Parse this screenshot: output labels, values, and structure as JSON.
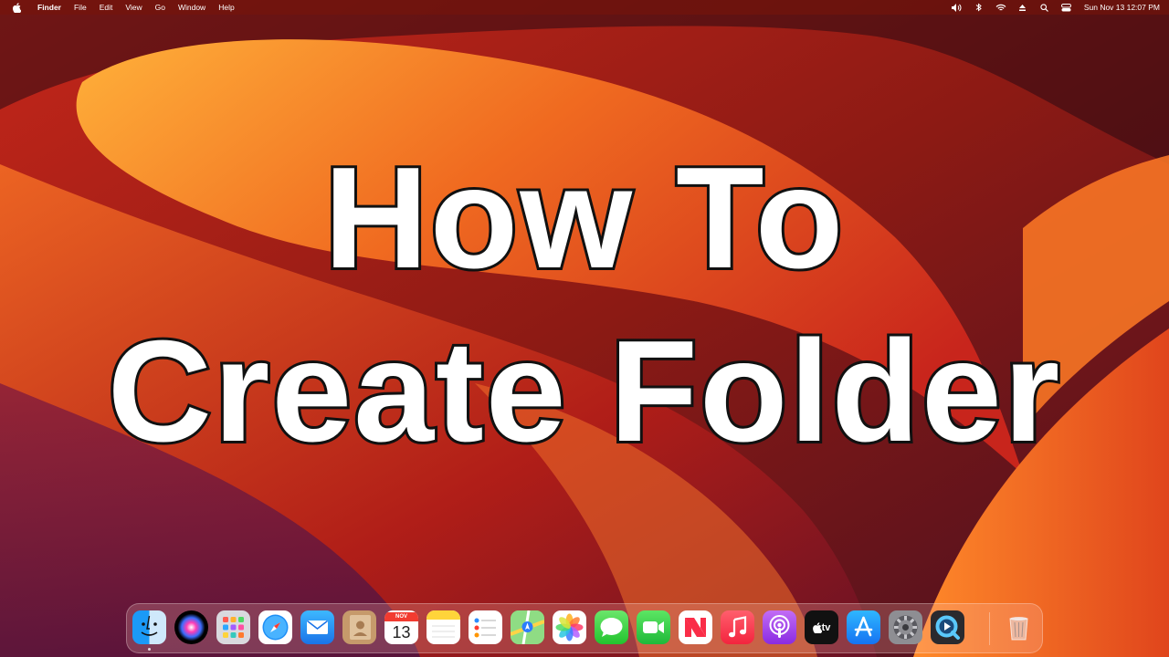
{
  "menubar": {
    "apple_icon": "apple-logo-icon",
    "items": [
      "Finder",
      "File",
      "Edit",
      "View",
      "Go",
      "Window",
      "Help"
    ],
    "status_icons": [
      "volume-icon",
      "bluetooth-icon",
      "wifi-icon",
      "eject-icon",
      "search-icon",
      "control-center-icon"
    ],
    "clock": "Sun Nov 13  12:07 PM"
  },
  "headline": {
    "line1": "How To",
    "line2": "Create Folder"
  },
  "dock": {
    "calendar_month": "NOV",
    "calendar_day": "13",
    "tv_label": "tv",
    "apps": [
      "Finder",
      "Siri",
      "Launchpad",
      "Safari",
      "Mail",
      "Contacts",
      "Calendar",
      "Notes",
      "Reminders",
      "Maps",
      "Photos",
      "Messages",
      "FaceTime",
      "News",
      "Music",
      "Podcasts",
      "TV",
      "App Store",
      "System Preferences",
      "QuickTime Player",
      "Trash"
    ]
  },
  "colors": {
    "wallpaper_base": "#7a1a14",
    "wallpaper_orange": "#f47a2a",
    "wallpaper_red": "#c8251c",
    "headline_fill": "#ffffff",
    "headline_stroke": "#111111"
  }
}
